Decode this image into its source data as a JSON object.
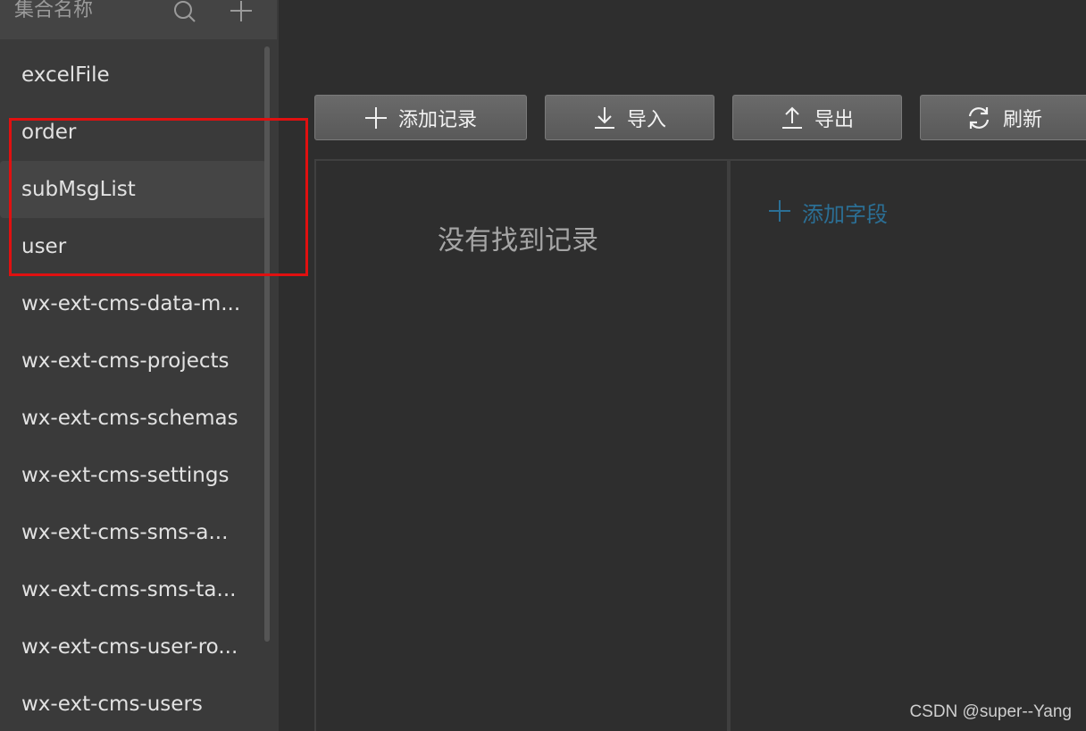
{
  "sidebar": {
    "title": "集合名称",
    "icons": {
      "search": "search-icon",
      "add": "plus-icon"
    },
    "items": [
      {
        "label": "excelFile",
        "active": false
      },
      {
        "label": "order",
        "active": false
      },
      {
        "label": "subMsgList",
        "active": true
      },
      {
        "label": "user",
        "active": false
      },
      {
        "label": "wx-ext-cms-data-m...",
        "active": false
      },
      {
        "label": "wx-ext-cms-projects",
        "active": false
      },
      {
        "label": "wx-ext-cms-schemas",
        "active": false
      },
      {
        "label": "wx-ext-cms-settings",
        "active": false
      },
      {
        "label": "wx-ext-cms-sms-a...",
        "active": false
      },
      {
        "label": "wx-ext-cms-sms-ta...",
        "active": false
      },
      {
        "label": "wx-ext-cms-user-ro...",
        "active": false
      },
      {
        "label": "wx-ext-cms-users",
        "active": false
      }
    ]
  },
  "toolbar": {
    "add_record": {
      "label": "添加记录",
      "icon": "plus-icon"
    },
    "import": {
      "label": "导入",
      "icon": "download-icon"
    },
    "export": {
      "label": "导出",
      "icon": "upload-icon"
    },
    "refresh": {
      "label": "刷新",
      "icon": "refresh-icon"
    }
  },
  "records": {
    "empty_message": "没有找到记录"
  },
  "fields": {
    "add_field_label": "添加字段",
    "add_field_icon": "plus-icon"
  },
  "watermark": "CSDN @super--Yang",
  "colors": {
    "annotation_box": "#e01010",
    "link_blue": "#2b6f95",
    "sidebar_bg": "#3a3a3a",
    "main_bg": "#2e2e2e"
  }
}
